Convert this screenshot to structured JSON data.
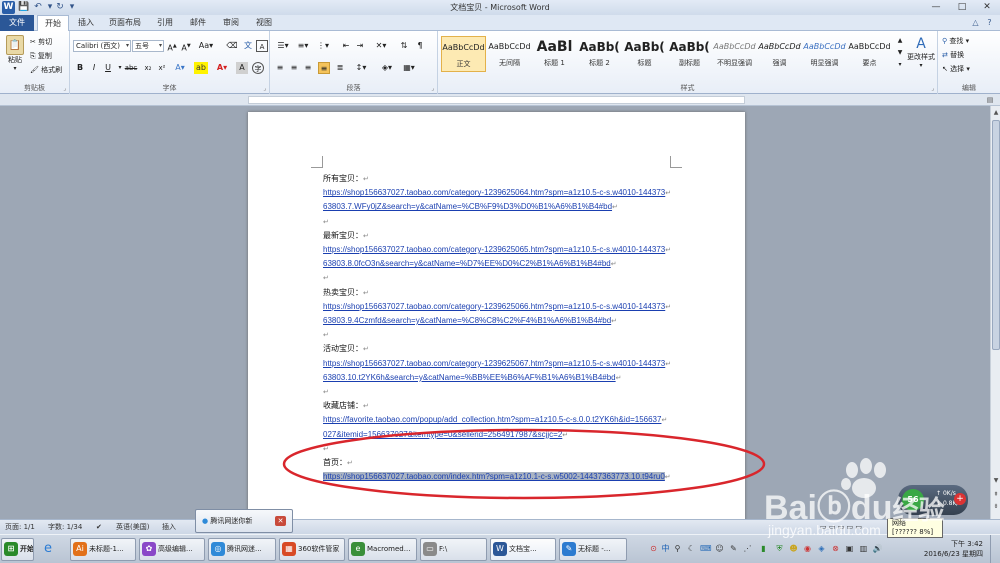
{
  "window": {
    "title": "文档宝贝 - Microsoft Word",
    "app_icon": "W",
    "window_controls": [
      "—",
      "□",
      "✕"
    ]
  },
  "tabs": {
    "file": "文件",
    "items": [
      "开始",
      "插入",
      "页面布局",
      "引用",
      "邮件",
      "审阅",
      "视图"
    ],
    "active": "开始"
  },
  "ribbon": {
    "clipboard": {
      "label": "剪贴板",
      "paste": "粘贴",
      "cut": "剪切",
      "copy": "复制",
      "format_painter": "格式刷"
    },
    "font": {
      "label": "字体",
      "font_name": "Calibri (西文)",
      "font_size": "五号"
    },
    "paragraph": {
      "label": "段落"
    },
    "styles": {
      "label": "样式",
      "items": [
        {
          "preview": "AaBbCcDd",
          "name": "正文"
        },
        {
          "preview": "AaBbCcDd",
          "name": "无间隔"
        },
        {
          "preview": "AaBl",
          "name": "标题 1"
        },
        {
          "preview": "AaBb(",
          "name": "标题 2"
        },
        {
          "preview": "AaBb(",
          "name": "标题"
        },
        {
          "preview": "AaBb(",
          "name": "副标题"
        },
        {
          "preview": "AaBbCcDd",
          "name": "不明显强调"
        },
        {
          "preview": "AaBbCcDd",
          "name": "强调"
        },
        {
          "preview": "AaBbCcDd",
          "name": "明显强调"
        },
        {
          "preview": "AaBbCcDd",
          "name": "要点"
        }
      ],
      "change_styles": "更改样式"
    },
    "editing": {
      "label": "编辑",
      "find": "查找",
      "replace": "替换",
      "select": "选择"
    }
  },
  "document": {
    "lines": [
      {
        "text": "所有宝贝：",
        "link": false
      },
      {
        "text": "https://shop156637027.taobao.com/category-1239625064.htm?spm=a1z10.5-c-s.w4010-144373",
        "link": true
      },
      {
        "text": "63803.7.WFy0jZ&search=y&catName=%CB%F9%D3%D0%B1%A6%B1%B4#bd",
        "link": true
      },
      {
        "text": "",
        "link": false
      },
      {
        "text": "最新宝贝：",
        "link": false
      },
      {
        "text": "https://shop156637027.taobao.com/category-1239625065.htm?spm=a1z10.5-c-s.w4010-144373",
        "link": true
      },
      {
        "text": "63803.8.0fcO3n&search=y&catName=%D7%EE%D0%C2%B1%A6%B1%B4#bd",
        "link": true
      },
      {
        "text": "",
        "link": false
      },
      {
        "text": "热卖宝贝：",
        "link": false
      },
      {
        "text": "https://shop156637027.taobao.com/category-1239625066.htm?spm=a1z10.5-c-s.w4010-144373",
        "link": true
      },
      {
        "text": "63803.9.4Czmfd&search=y&catName=%C8%C8%C2%F4%B1%A6%B1%B4#bd",
        "link": true
      },
      {
        "text": "",
        "link": false
      },
      {
        "text": "活动宝贝：",
        "link": false
      },
      {
        "text": "https://shop156637027.taobao.com/category-1239625067.htm?spm=a1z10.5-c-s.w4010-144373",
        "link": true
      },
      {
        "text": "63803.10.t2YK6h&search=y&catName=%BB%EE%B6%AF%B1%A6%B1%B4#bd",
        "link": true
      },
      {
        "text": "",
        "link": false
      },
      {
        "text": "收藏店铺：",
        "link": false
      },
      {
        "text": "https://favorite.taobao.com/popup/add_collection.htm?spm=a1z10.5-c-s.0.0.t2YK6h&id=156637",
        "link": true
      },
      {
        "text": "027&itemid=156637027&itemtype=0&sellerid=2564917987&scjjc=2",
        "link": true
      },
      {
        "text": "",
        "link": false
      },
      {
        "text": "首页：",
        "link": false
      },
      {
        "text": "https://shop156637027.taobao.com/index.htm?spm=a1z10.1-c-s.w5002-14437363773.10.t94ru0",
        "link": true,
        "selected": true
      }
    ],
    "paragraph_mark": "↵",
    "annotation_color": "#d9262c"
  },
  "statusbar": {
    "page": "页面: 1/1",
    "words": "字数: 1/34",
    "language": "英语(美国)",
    "insert": "插入"
  },
  "popup": {
    "text": "腾讯网迷你新"
  },
  "net_widget": {
    "badge": "56",
    "up": "0K/s",
    "down": "0.8K/s",
    "tooltip_title": "网络",
    "tooltip_extra": "[?????? 8%]"
  },
  "taskbar": {
    "start": "开始",
    "items": [
      {
        "label": "未标题-1...",
        "color": "#e2711a",
        "glyph": "Ai"
      },
      {
        "label": "高级编辑...",
        "color": "#8a48c8",
        "glyph": "✿"
      },
      {
        "label": "腾讯网迷...",
        "color": "#2f8ad8",
        "glyph": "◎"
      },
      {
        "label": "360软件管家",
        "color": "#d84a25",
        "glyph": "▦"
      },
      {
        "label": "Macromed...",
        "color": "#3a8f3a",
        "glyph": "e"
      },
      {
        "label": "F:\\",
        "color": "#8a8a8a",
        "glyph": "▭"
      },
      {
        "label": "文档宝...",
        "color": "#2b5797",
        "glyph": "W"
      },
      {
        "label": "无标题 -...",
        "color": "#2c7bd0",
        "glyph": "✎"
      }
    ],
    "clock_time": "下午 3:42",
    "clock_date": "2016/6/23 星期四"
  },
  "watermark": {
    "brand": "Bai",
    "brand2": "du",
    "suffix": "经验",
    "url": "jingyan.baidu.com"
  }
}
